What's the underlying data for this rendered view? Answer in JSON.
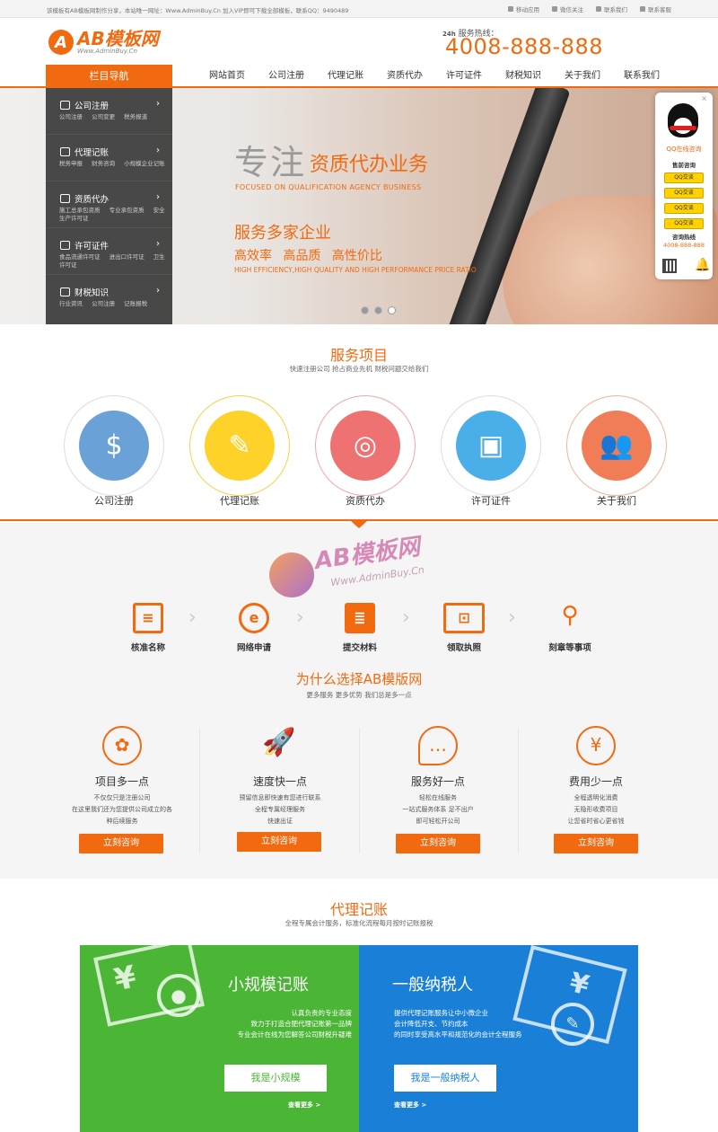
{
  "topbar": {
    "notice": "该模板有AB模板网制作分享，本站唯一网址：Www.AdminBuy.Cn 加入VIP即可下载全部模板，联系QQ：9490489",
    "links": [
      "移动应用",
      "微信关注",
      "联系我们",
      "联系客服"
    ]
  },
  "header": {
    "logo_main": "AB模板网",
    "logo_sub": "Www.AdminBuy.Cn",
    "hotline_label": "服务热线：",
    "hotline_number": "4008-888-888"
  },
  "nav": {
    "title": "栏目导航",
    "items": [
      "网站首页",
      "公司注册",
      "代理记账",
      "资质代办",
      "许可证件",
      "财税知识",
      "关于我们",
      "联系我们"
    ]
  },
  "side_menu": [
    {
      "title": "公司注册",
      "links": "公司注册 公司变更 税务报道"
    },
    {
      "title": "代理记账",
      "links": "税务申报 财务咨询 小规模企业记账"
    },
    {
      "title": "资质代办",
      "links": "施工总承包资质 专业承包资质 安全生产许可证"
    },
    {
      "title": "许可证件",
      "links": "食品流通许可证 进出口许可证 卫生许可证"
    },
    {
      "title": "财税知识",
      "links": "行业资讯 公司注册 记账报税"
    }
  ],
  "banner": {
    "h1a": "专注",
    "h1b": "资质代办业务",
    "sub1": "FOCUSED ON QUALIFICATION AGENCY BUSINESS",
    "h2": "服务多家企业",
    "h3": "高效率 高品质 高性价比",
    "sub2": "HIGH EFFICIENCY,HIGH QUALITY AND HIGH PERFORMANCE PRICE RATIO"
  },
  "qq": {
    "title": "QQ在线咨询",
    "consult": "售前咨询",
    "buttons": [
      "QQ交谈",
      "QQ交谈",
      "QQ交谈",
      "QQ交谈"
    ],
    "hotline_label": "咨询热线",
    "hotline": "4008-888-888",
    "close": "×"
  },
  "services": {
    "title": "服务项目",
    "subtitle": "快速注册公司 抢占商业先机 财税问题交给我们",
    "items": [
      "公司注册",
      "代理记账",
      "资质代办",
      "许可证件",
      "关于我们"
    ]
  },
  "watermark": {
    "text": "AB模板网",
    "url": "Www.AdminBuy.Cn"
  },
  "process": [
    "核准名称",
    "网络申请",
    "提交材料",
    "领取执照",
    "刻章等事项"
  ],
  "why": {
    "title": "为什么选择AB模版网",
    "subtitle": "更多服务 更多优势 我们总是多一点",
    "items": [
      {
        "title": "项目多一点",
        "desc": [
          "不仅仅只是注册公司",
          "在这里我们还为您提供公司成立的各",
          "种后续服务"
        ],
        "button": "立刻咨询"
      },
      {
        "title": "速度快一点",
        "desc": [
          "预留信息即快速有您进行联系",
          "全程专属经理服务",
          "快速出证"
        ],
        "button": "立刻咨询"
      },
      {
        "title": "服务好一点",
        "desc": [
          "轻松在线服务",
          "一站式服务体系 足不出户",
          "即可轻松开公司"
        ],
        "button": "立刻咨询"
      },
      {
        "title": "费用少一点",
        "desc": [
          "全程透明化消费",
          "无隐形收费项目",
          "让您省时省心更省钱"
        ],
        "button": "立刻咨询"
      }
    ]
  },
  "bookkeeping": {
    "title": "代理记账",
    "subtitle": "全程专属会计服务，标准化流程每月按时记账报税",
    "left": {
      "title": "小规模记账",
      "desc": [
        "认真负责的专业态度",
        "致力于打造合肥代理记账第一品牌",
        "专业会计在线为您解答公司财税升疑难"
      ],
      "button": "我是小规模",
      "more": "查看更多 >",
      "color": "#4bb536"
    },
    "right": {
      "title": "一般纳税人",
      "desc": [
        "提供代理记账服务让中小微企业",
        "会计降低开支、节约成本",
        "的同时享受高水平和规范化的会计全程服务"
      ],
      "button": "我是一般纳税人",
      "more": "查看更多 >",
      "color": "#1a7fd6"
    }
  }
}
